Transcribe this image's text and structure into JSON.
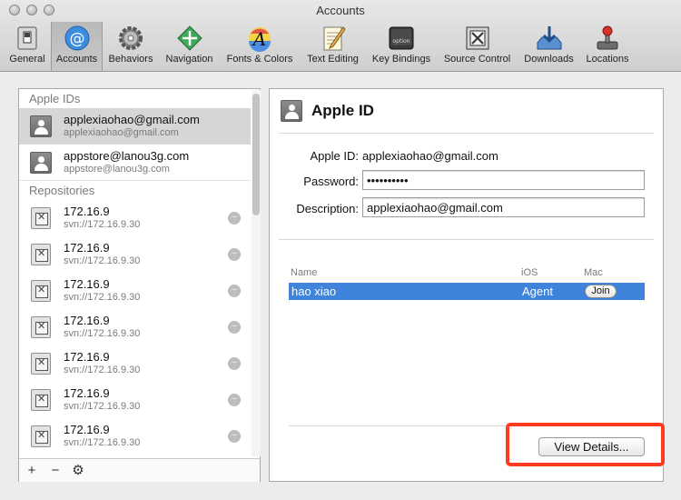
{
  "window": {
    "title": "Accounts"
  },
  "toolbar": {
    "items": [
      {
        "label": "General",
        "icon": "general-switch-icon"
      },
      {
        "label": "Accounts",
        "icon": "at-sign-icon"
      },
      {
        "label": "Behaviors",
        "icon": "gear-icon"
      },
      {
        "label": "Navigation",
        "icon": "navigation-arrows-icon"
      },
      {
        "label": "Fonts & Colors",
        "icon": "font-a-icon"
      },
      {
        "label": "Text Editing",
        "icon": "pencil-notepad-icon"
      },
      {
        "label": "Key Bindings",
        "icon": "option-key-icon"
      },
      {
        "label": "Source Control",
        "icon": "source-control-icon"
      },
      {
        "label": "Downloads",
        "icon": "download-tray-icon"
      },
      {
        "label": "Locations",
        "icon": "joystick-icon"
      }
    ],
    "selected": "Accounts"
  },
  "sidebar": {
    "apple_ids_header": "Apple IDs",
    "accounts": [
      {
        "title": "applexiaohao@gmail.com",
        "subtitle": "applexiaohao@gmail.com"
      },
      {
        "title": "appstore@lanou3g.com",
        "subtitle": "appstore@lanou3g.com"
      }
    ],
    "repositories_header": "Repositories",
    "repositories": [
      {
        "title": "172.16.9",
        "subtitle": "svn://172.16.9.30"
      },
      {
        "title": "172.16.9",
        "subtitle": "svn://172.16.9.30"
      },
      {
        "title": "172.16.9",
        "subtitle": "svn://172.16.9.30"
      },
      {
        "title": "172.16.9",
        "subtitle": "svn://172.16.9.30"
      },
      {
        "title": "172.16.9",
        "subtitle": "svn://172.16.9.30"
      },
      {
        "title": "172.16.9",
        "subtitle": "svn://172.16.9.30"
      },
      {
        "title": "172.16.9",
        "subtitle": "svn://172.16.9.30"
      }
    ],
    "footer": {
      "add": "+",
      "remove": "−",
      "settings": "⚙"
    }
  },
  "detail": {
    "title": "Apple ID",
    "apple_id_label": "Apple ID:",
    "apple_id_value": "applexiaohao@gmail.com",
    "password_label": "Password:",
    "password_value": "••••••••••",
    "description_label": "Description:",
    "description_value": "applexiaohao@gmail.com",
    "table": {
      "columns": [
        "Name",
        "iOS",
        "Mac"
      ],
      "rows": [
        {
          "name": "hao xiao",
          "ios": "Agent",
          "mac": "Join"
        }
      ]
    },
    "view_details_label": "View Details..."
  },
  "colors": {
    "selection": "#3e84dc",
    "highlight": "#ff3b1f"
  }
}
